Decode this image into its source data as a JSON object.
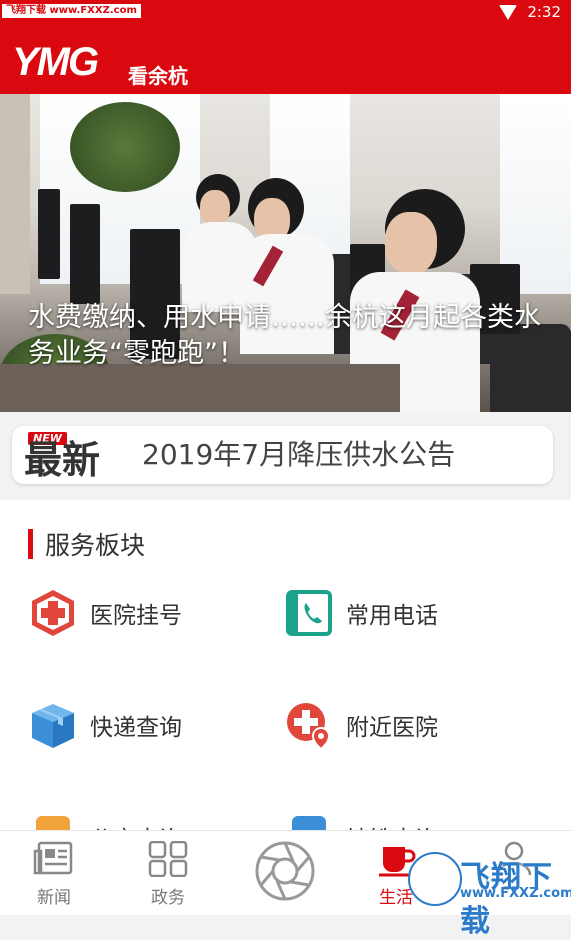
{
  "status_bar": {
    "watermark": "飞翔下载 www.FXXZ.com",
    "time": "2:32"
  },
  "header": {
    "logo_mark": "YMG",
    "logo_text": "看余杭"
  },
  "banner": {
    "caption": "水费缴纳、用水申请……余杭这月起各类水务业务“零跑跑”！",
    "slide_count": 5,
    "active_slide": 1
  },
  "news": {
    "badge": "NEW",
    "label": "最新",
    "title": "2019年7月降压供水公告"
  },
  "services": {
    "section_title": "服务板块",
    "items": [
      {
        "label": "医院挂号",
        "icon": "hospital-cross-icon"
      },
      {
        "label": "常用电话",
        "icon": "phone-book-icon"
      },
      {
        "label": "快递查询",
        "icon": "package-box-icon"
      },
      {
        "label": "附近医院",
        "icon": "hospital-location-icon"
      },
      {
        "label": "公交查询",
        "icon": "bus-icon"
      },
      {
        "label": "地铁查询",
        "icon": "metro-icon"
      }
    ]
  },
  "tabs": [
    {
      "label": "新闻",
      "icon": "newspaper-icon"
    },
    {
      "label": "政务",
      "icon": "grid-icon"
    },
    {
      "label": "",
      "icon": "camera-aperture-icon"
    },
    {
      "label": "生活",
      "icon": "coffee-cup-icon",
      "active": true
    },
    {
      "label": "",
      "icon": "user-icon"
    }
  ],
  "watermark": {
    "brand": "飞翔下载",
    "url": "www.FXXZ.com"
  },
  "colors": {
    "brand_red": "#d9090f",
    "service_red": "#e0463a",
    "teal": "#1aa38a",
    "blue": "#3a8fd6",
    "watermark_blue": "#2b7bc9"
  }
}
